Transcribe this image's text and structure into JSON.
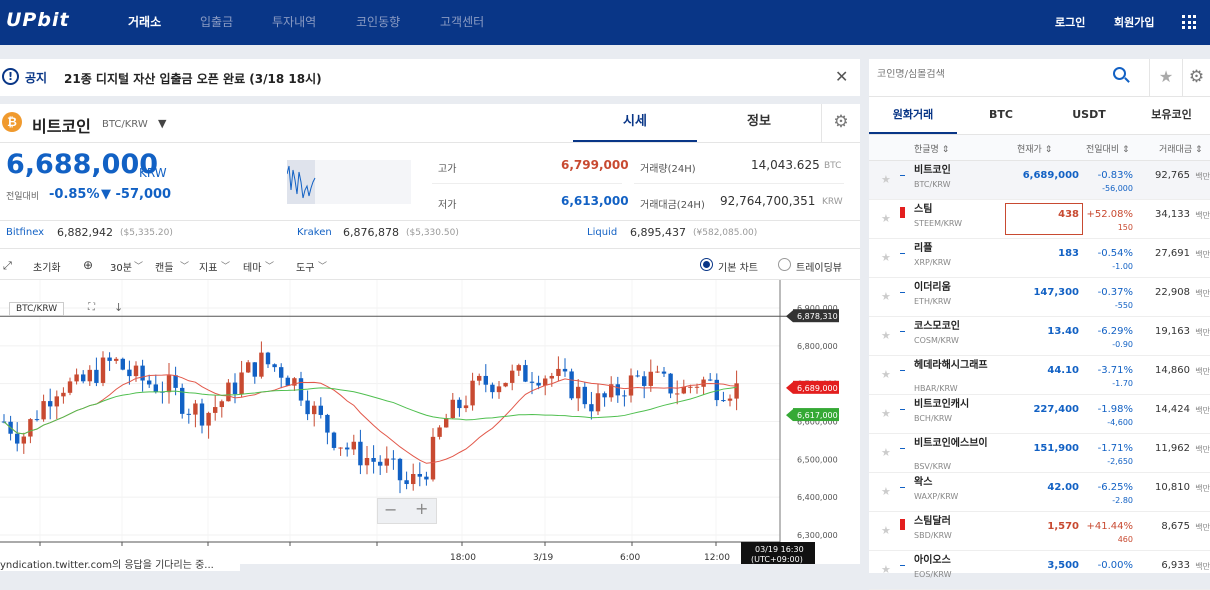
{
  "header": {
    "logo": "UPbit",
    "nav": [
      "거래소",
      "입출금",
      "투자내역",
      "코인동향",
      "고객센터"
    ],
    "login": "로그인",
    "signup": "회원가입"
  },
  "notice": {
    "label": "공지",
    "text": "21종 디지털 자산 입출금 오픈 완료 (3/18 18시)"
  },
  "coin": {
    "name": "비트코인",
    "pair": "BTC/KRW",
    "price": "6,688,000",
    "currency": "KRW",
    "change_label": "전일대비",
    "change_pct": "-0.85%",
    "change_amt": "▼ -57,000",
    "high_label": "고가",
    "high": "6,799,000",
    "low_label": "저가",
    "low": "6,613,000",
    "vol_label": "거래량(24H)",
    "vol": "14,043.625",
    "vol_unit": "BTC",
    "amt_label": "거래대금(24H)",
    "amt": "92,764,700,351",
    "amt_unit": "KRW",
    "tab_price": "시세",
    "tab_info": "정보"
  },
  "exchanges": [
    {
      "name": "Bitfinex",
      "price": "6,882,942",
      "usd": "($5,335.20)"
    },
    {
      "name": "Kraken",
      "price": "6,876,878",
      "usd": "($5,330.50)"
    },
    {
      "name": "Liquid",
      "price": "6,895,437",
      "usd": "(¥582,085.00)"
    }
  ],
  "toolbar": {
    "reset": "초기화",
    "interval": "30분",
    "candle": "캔들",
    "indicator": "지표",
    "theme": "테마",
    "tools": "도구",
    "basic": "기본 차트",
    "tv": "트레이딩뷰"
  },
  "chart": {
    "pair": "BTC/KRW",
    "y_ticks": [
      "6,900,000",
      "6,800,000",
      "6,700,000",
      "6,600,000",
      "6,500,000",
      "6,400,000",
      "6,300,000"
    ],
    "x_ticks": [
      "18:00",
      "3/19",
      "6:00",
      "12:00"
    ],
    "tag_high": "6,878,310",
    "tag_cur": "6,689,000",
    "tag_ma": "6,617,000",
    "time_tag": "03/19 16:30",
    "tz": "(UTC+09:00)",
    "status": "yndication.twitter.com의 응답을 기다리는 중..."
  },
  "search": {
    "placeholder": "코인명/심볼검색"
  },
  "market_tabs": [
    "원화거래",
    "BTC",
    "USDT",
    "보유코인"
  ],
  "columns": [
    "한글명",
    "현재가",
    "전일대비",
    "거래대금"
  ],
  "coins": [
    {
      "name": "비트코인",
      "sym": "BTC/KRW",
      "price": "6,689,000",
      "pct": "-0.83%",
      "chg": "-56,000",
      "vol": "92,765",
      "unit": "백만",
      "up": false
    },
    {
      "name": "스팀",
      "sym": "STEEM/KRW",
      "price": "438",
      "pct": "+52.08%",
      "chg": "150",
      "vol": "34,133",
      "unit": "백만",
      "up": true
    },
    {
      "name": "리플",
      "sym": "XRP/KRW",
      "price": "183",
      "pct": "-0.54%",
      "chg": "-1.00",
      "vol": "27,691",
      "unit": "백만",
      "up": false
    },
    {
      "name": "이더리움",
      "sym": "ETH/KRW",
      "price": "147,300",
      "pct": "-0.37%",
      "chg": "-550",
      "vol": "22,908",
      "unit": "백만",
      "up": false
    },
    {
      "name": "코스모코인",
      "sym": "COSM/KRW",
      "price": "13.40",
      "pct": "-6.29%",
      "chg": "-0.90",
      "vol": "19,163",
      "unit": "백만",
      "up": false
    },
    {
      "name": "헤데라해시그래프",
      "sym": "HBAR/KRW",
      "price": "44.10",
      "pct": "-3.71%",
      "chg": "-1.70",
      "vol": "14,860",
      "unit": "백만",
      "up": false
    },
    {
      "name": "비트코인캐시",
      "sym": "BCH/KRW",
      "price": "227,400",
      "pct": "-1.98%",
      "chg": "-4,600",
      "vol": "14,424",
      "unit": "백만",
      "up": false
    },
    {
      "name": "비트코인에스브이",
      "sym": "BSV/KRW",
      "price": "151,900",
      "pct": "-1.71%",
      "chg": "-2,650",
      "vol": "11,962",
      "unit": "백만",
      "up": false
    },
    {
      "name": "왁스",
      "sym": "WAXP/KRW",
      "price": "42.00",
      "pct": "-6.25%",
      "chg": "-2.80",
      "vol": "10,810",
      "unit": "백만",
      "up": false
    },
    {
      "name": "스팀달러",
      "sym": "SBD/KRW",
      "price": "1,570",
      "pct": "+41.44%",
      "chg": "460",
      "vol": "8,675",
      "unit": "백만",
      "up": true
    },
    {
      "name": "아이오스",
      "sym": "EOS/KRW",
      "price": "3,500",
      "pct": "-0.00%",
      "chg": "",
      "vol": "6,933",
      "unit": "백만",
      "up": false
    }
  ],
  "colors": {
    "brand": "#093687",
    "up": "#c84a31",
    "down": "#1261c4"
  }
}
